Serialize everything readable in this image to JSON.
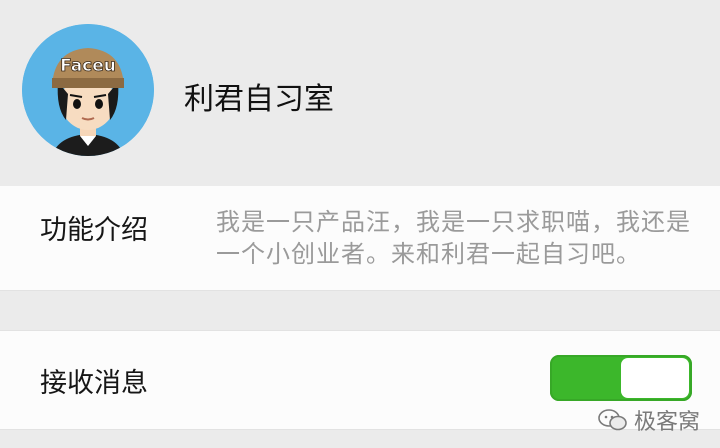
{
  "profile": {
    "name": "利君自习室",
    "avatar_text": "Faceu"
  },
  "intro": {
    "label": "功能介绍",
    "text": "我是一只产品汪，我是一只求职喵，我还是一个小创业者。来和利君一起自习吧。"
  },
  "messages": {
    "label": "接收消息",
    "toggle_on": true
  },
  "colors": {
    "background": "#ebebeb",
    "card": "#fcfcfc",
    "toggle_on": "#3cb72b",
    "avatar_bg": "#5ab4e6"
  },
  "watermark": {
    "text": "极客窝"
  }
}
